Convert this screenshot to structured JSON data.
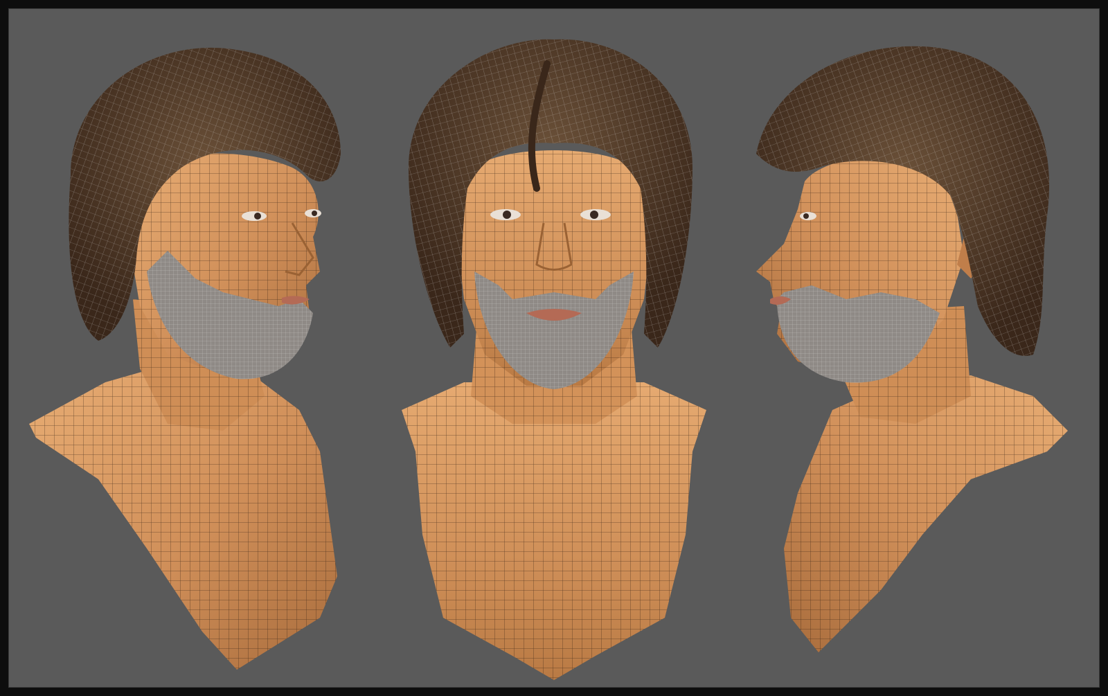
{
  "scene": {
    "views": [
      {
        "id": "three-quarter-left",
        "facing": "right"
      },
      {
        "id": "front",
        "facing": "viewer"
      },
      {
        "id": "profile-right",
        "facing": "left"
      }
    ],
    "colors": {
      "frame": "#0d0d0d",
      "background": "#5a5a5a",
      "skin_light": "#e3a66d",
      "skin_mid": "#c98a55",
      "skin_shadow": "#9a6234",
      "hair_dark": "#3e2a1c",
      "hair_mid": "#5a4330",
      "beard": "#8f8a86",
      "wire_skin": "#2a1a10",
      "wire_hair": "#d8d8d8",
      "lips": "#b46a55"
    }
  }
}
